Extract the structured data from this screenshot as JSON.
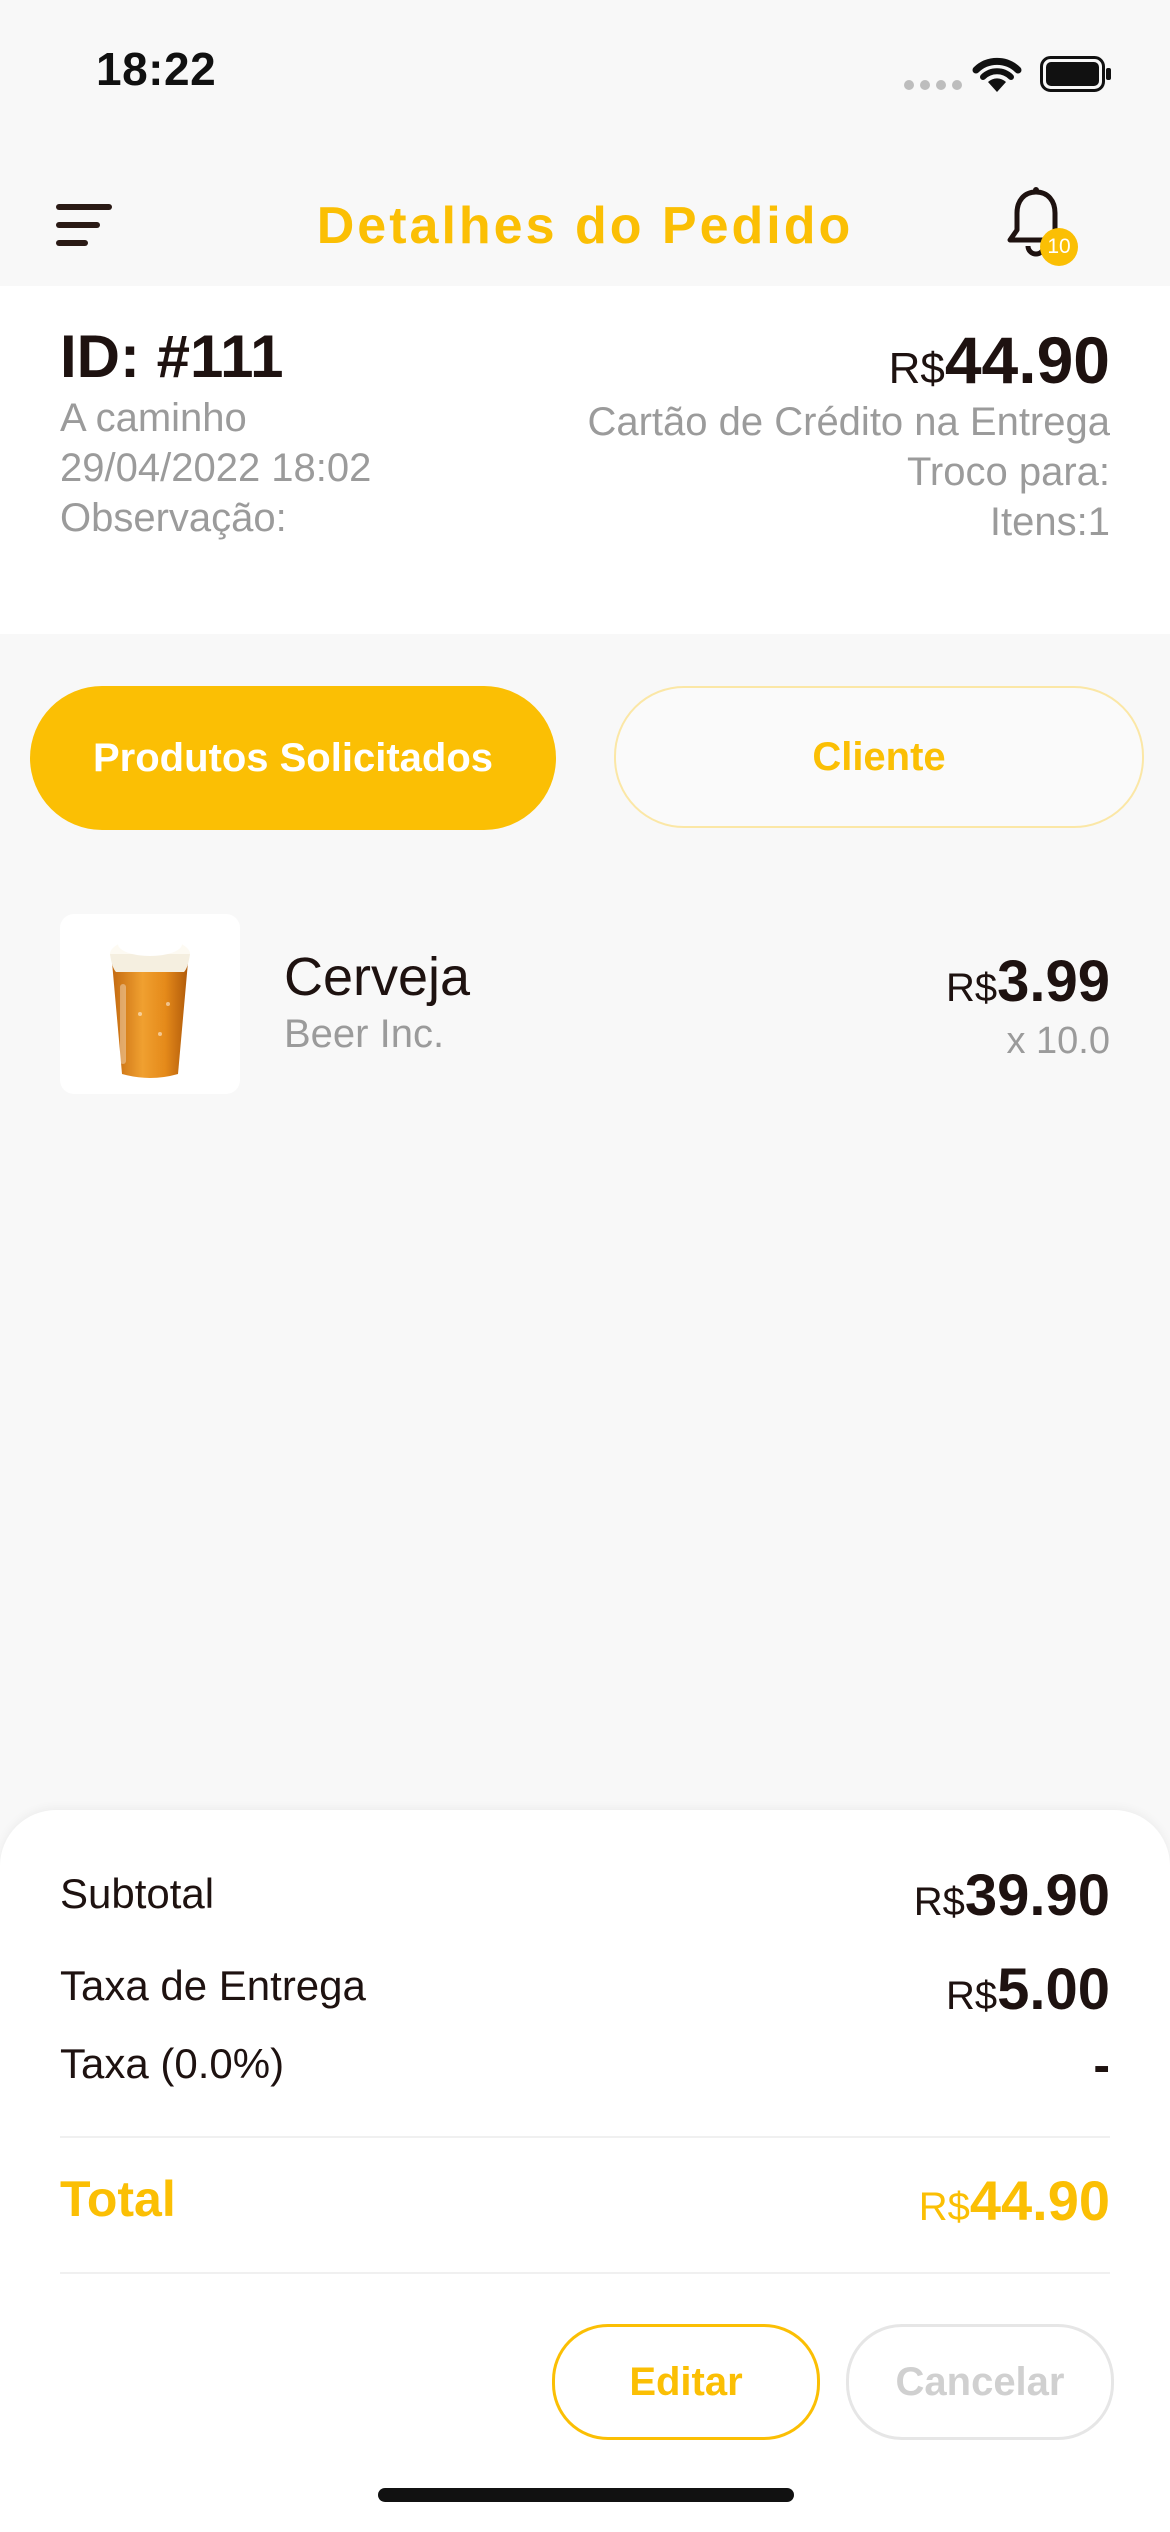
{
  "status_bar": {
    "time": "18:22"
  },
  "header": {
    "title": "Detalhes do Pedido",
    "notification_count": "10"
  },
  "order": {
    "id": "ID: #111",
    "status": "A caminho",
    "datetime": "29/04/2022 18:02",
    "note_label": "Observação:",
    "total_currency": "R$",
    "total_amount": "44.90",
    "payment_method": "Cartão de Crédito na Entrega",
    "change_label": "Troco para:",
    "items_label": "Itens:1"
  },
  "tabs": [
    {
      "label": "Produtos Solicitados",
      "active": true
    },
    {
      "label": "Cliente",
      "active": false
    }
  ],
  "products": [
    {
      "name": "Cerveja",
      "brand": "Beer Inc.",
      "currency": "R$",
      "price": "3.99",
      "quantity": "x 10.0",
      "image_icon": "beer-glass-icon"
    }
  ],
  "summary": {
    "subtotal_label": "Subtotal",
    "subtotal_currency": "R$",
    "subtotal_value": "39.90",
    "delivery_label": "Taxa de Entrega",
    "delivery_currency": "R$",
    "delivery_value": "5.00",
    "tax_label": "Taxa (0.0%)",
    "tax_value": "-",
    "total_label": "Total",
    "total_currency": "R$",
    "total_value": "44.90"
  },
  "actions": {
    "edit_label": "Editar",
    "cancel_label": "Cancelar"
  },
  "colors": {
    "accent": "#fbbf04",
    "text_dark": "#1e1210",
    "text_muted": "#9b9b9b",
    "background": "#f8f8f8"
  }
}
